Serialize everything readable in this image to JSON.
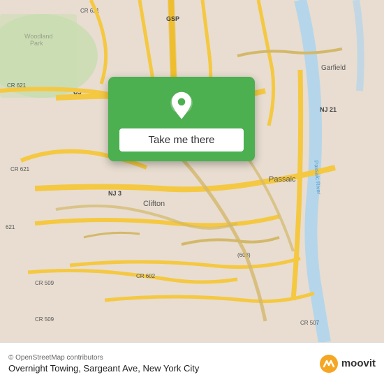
{
  "map": {
    "background_color": "#e8ddd0",
    "road_color": "#f5c842",
    "road_outline": "#e0a800",
    "green_area": "#c8ddb0",
    "water_color": "#a8d4f0"
  },
  "card": {
    "background": "#4caf50",
    "button_label": "Take me there",
    "pin_color": "white"
  },
  "bottom_bar": {
    "copyright": "© OpenStreetMap contributors",
    "location_title": "Overnight Towing, Sargeant Ave, New York City",
    "moovit_label": "moovit"
  }
}
